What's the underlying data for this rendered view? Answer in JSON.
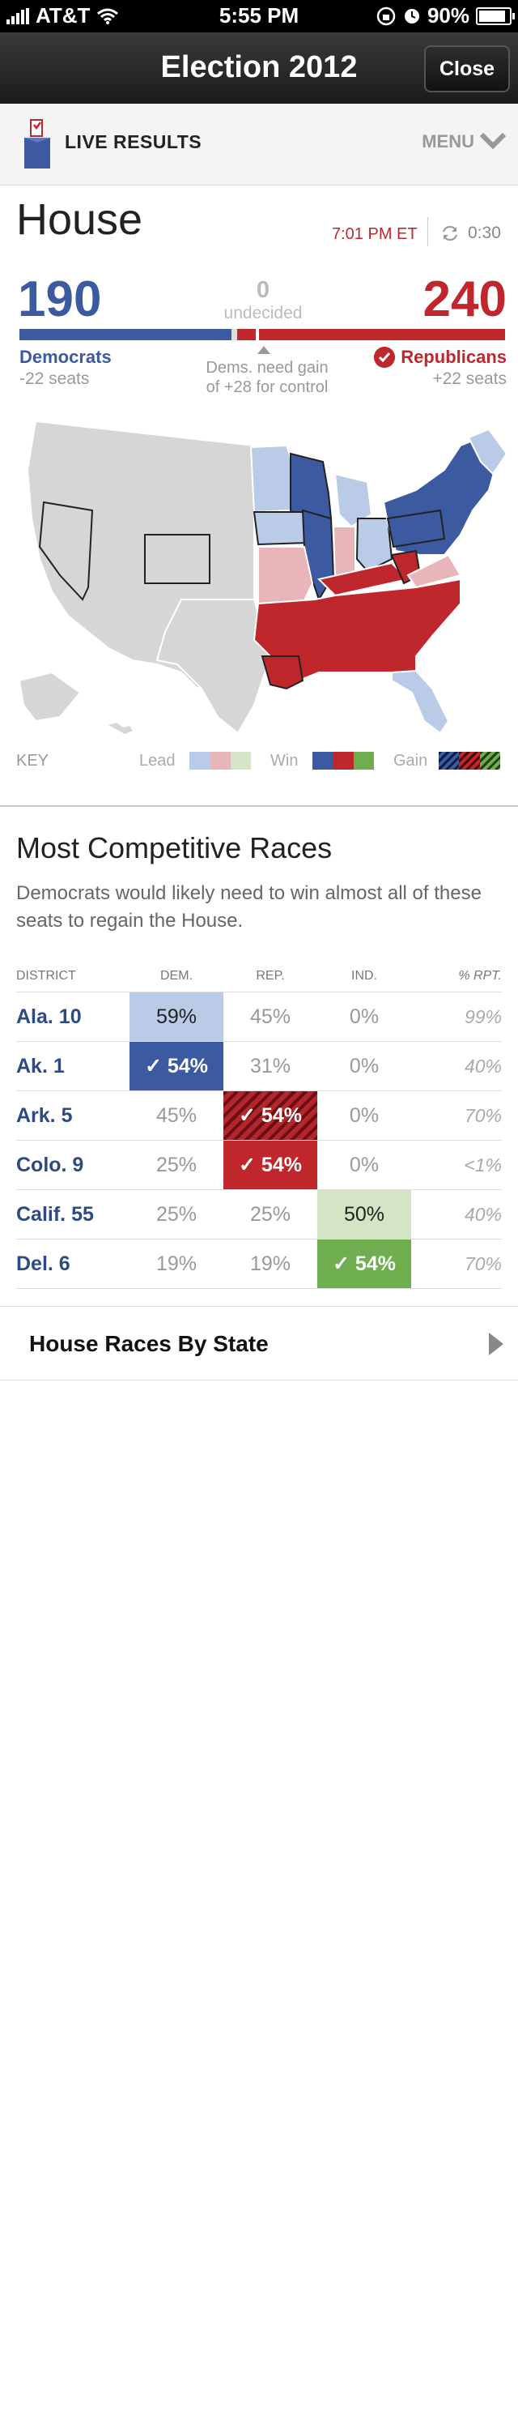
{
  "status": {
    "carrier": "AT&T",
    "time": "5:55 PM",
    "battery": "90%",
    "battery_level": 0.9
  },
  "nav": {
    "title": "Election 2012",
    "close_label": "Close"
  },
  "live": {
    "label": "LIVE RESULTS",
    "menu_label": "MENU"
  },
  "house": {
    "title": "House",
    "timestamp": "7:01 PM ET",
    "countdown": "0:30",
    "dem_count": "190",
    "rep_count": "240",
    "undecided_count": "0",
    "undecided_label": "undecided",
    "dem_name": "Democrats",
    "dem_seats": "-22 seats",
    "rep_name": "Republicans",
    "rep_seats": "+22 seats",
    "need_line1": "Dems. need gain",
    "need_line2": "of +28 for control"
  },
  "key": {
    "label": "KEY",
    "lead": "Lead",
    "win": "Win",
    "gain": "Gain"
  },
  "colors": {
    "dem": "#3b5aa0",
    "rep": "#c0272d",
    "dem_lead": "#b9cbe6",
    "rep_lead": "#e8b6b8",
    "ind_lead": "#d3e5c4",
    "ind_win": "#6fae4e",
    "neutral": "#d6d6d6"
  },
  "races": {
    "title": "Most Competitive Races",
    "description": "Democrats would likely need to win almost all of these seats to regain the House.",
    "headers": [
      "DISTRICT",
      "DEM.",
      "REP.",
      "IND.",
      "% RPT."
    ],
    "rows": [
      {
        "district": "Ala. 10",
        "dem": "59%",
        "rep": "45%",
        "ind": "0%",
        "rpt": "99%"
      },
      {
        "district": "Ak. 1",
        "dem": "54%",
        "rep": "31%",
        "ind": "0%",
        "rpt": "40%"
      },
      {
        "district": "Ark. 5",
        "dem": "45%",
        "rep": "54%",
        "ind": "0%",
        "rpt": "70%"
      },
      {
        "district": "Colo. 9",
        "dem": "25%",
        "rep": "54%",
        "ind": "0%",
        "rpt": "<1%"
      },
      {
        "district": "Calif. 55",
        "dem": "25%",
        "rep": "25%",
        "ind": "50%",
        "rpt": "40%"
      },
      {
        "district": "Del. 6",
        "dem": "19%",
        "rep": "19%",
        "ind": "54%",
        "rpt": "70%"
      }
    ]
  },
  "by_state": {
    "label": "House Races By State"
  }
}
